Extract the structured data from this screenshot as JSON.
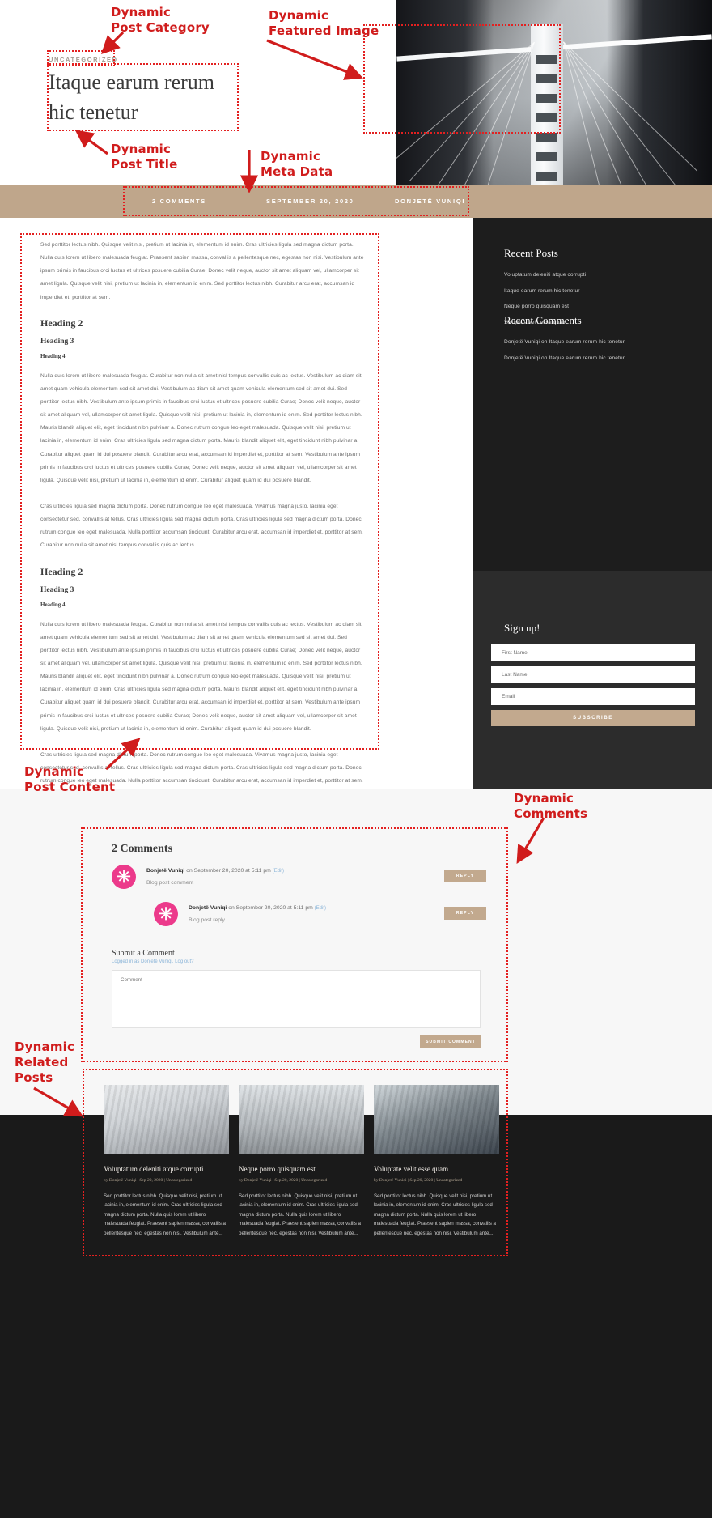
{
  "annotations": [
    {
      "id": "post-category",
      "label": "Dynamic\nPost Category"
    },
    {
      "id": "featured-image",
      "label": "Dynamic\nFeatured Image"
    },
    {
      "id": "post-title",
      "label": "Dynamic\nPost Title"
    },
    {
      "id": "meta-data",
      "label": "Dynamic\nMeta Data"
    },
    {
      "id": "post-content",
      "label": "Dynamic\nPost Content"
    },
    {
      "id": "comments",
      "label": "Dynamic\nComments"
    },
    {
      "id": "related-posts",
      "label": "Dynamic\nRelated\nPosts"
    }
  ],
  "colors": {
    "annotation_red": "#d01c1c",
    "dash_red": "#e32020",
    "meta_bar_tan": "#bfa68b",
    "button_tan": "#c2a98e",
    "sidebar_dark": "#1d1d1d",
    "signup_dark": "#2c2c2c",
    "related_dark": "#1a1a1a",
    "avatar_pink": "#ec3a8b",
    "link_blue": "#8ab4d8"
  },
  "hero": {
    "category": "UNCATEGORIZED",
    "title": "Itaque earum rerum hic tenetur",
    "featured_image_alt": "bridge-tower-photo"
  },
  "meta": {
    "comments": "2 COMMENTS",
    "date": "SEPTEMBER 20, 2020",
    "author": "DONJETË VUNIQI"
  },
  "article": {
    "p1": "Sed porttitor lectus nibh. Quisque velit nisi, pretium ut lacinia in, elementum id enim. Cras ultricies ligula sed magna dictum porta. Nulla quis lorem ut libero malesuada feugiat. Praesent sapien massa, convallis a pellentesque nec, egestas non nisi. Vestibulum ante ipsum primis in faucibus orci luctus et ultrices posuere cubilia Curae; Donec velit neque, auctor sit amet aliquam vel, ullamcorper sit amet ligula. Quisque velit nisi, pretium ut lacinia in, elementum id enim. Sed porttitor lectus nibh. Curabitur arcu erat, accumsan id imperdiet et, porttitor at sem.",
    "h2": "Heading 2",
    "h3": "Heading 3",
    "h4": "Heading 4",
    "p2": "Nulla quis lorem ut libero malesuada feugiat. Curabitur non nulla sit amet nisl tempus convallis quis ac lectus. Vestibulum ac diam sit amet quam vehicula elementum sed sit amet dui. Vestibulum ac diam sit amet quam vehicula elementum sed sit amet dui. Sed porttitor lectus nibh. Vestibulum ante ipsum primis in faucibus orci luctus et ultrices posuere cubilia Curae; Donec velit neque, auctor sit amet aliquam vel, ullamcorper sit amet ligula. Quisque velit nisi, pretium ut lacinia in, elementum id enim. Sed porttitor lectus nibh. Mauris blandit aliquet elit, eget tincidunt nibh pulvinar a. Donec rutrum congue leo eget malesuada. Quisque velit nisi, pretium ut lacinia in, elementum id enim. Cras ultricies ligula sed magna dictum porta. Mauris blandit aliquet elit, eget tincidunt nibh pulvinar a. Curabitur aliquet quam id dui posuere blandit. Curabitur arcu erat, accumsan id imperdiet et, porttitor at sem. Vestibulum ante ipsum primis in faucibus orci luctus et ultrices posuere cubilia Curae; Donec velit neque, auctor sit amet aliquam vel, ullamcorper sit amet ligula. Quisque velit nisi, pretium ut lacinia in, elementum id enim. Curabitur aliquet quam id dui posuere blandit.",
    "p3": "Cras ultricies ligula sed magna dictum porta. Donec rutrum congue leo eget malesuada. Vivamus magna justo, lacinia eget consectetur sed, convallis at tellus. Cras ultricies ligula sed magna dictum porta. Cras ultricies ligula sed magna dictum porta. Donec rutrum congue leo eget malesuada. Nulla porttitor accumsan tincidunt. Curabitur arcu erat, accumsan id imperdiet et, porttitor at sem. Curabitur non nulla sit amet nisl tempus convallis quis ac lectus."
  },
  "sidebar": {
    "recent_posts_title": "Recent Posts",
    "recent_posts": [
      "Voluptatum deleniti atque corrupti",
      "Itaque earum rerum hic tenetur",
      "Neque porro quisquam est",
      "Voluptate velit esse quam"
    ],
    "recent_comments_title": "Recent Comments",
    "recent_comments": [
      "Donjetë Vuniqi on Itaque earum rerum hic tenetur",
      "Donjetë Vuniqi on Itaque earum rerum hic tenetur"
    ]
  },
  "signup": {
    "title": "Sign up!",
    "first_name_placeholder": "First Name",
    "last_name_placeholder": "Last Name",
    "email_placeholder": "Email",
    "subscribe_label": "SUBSCRIBE"
  },
  "comments_section": {
    "heading": "2 Comments",
    "avatar_glyph": "✳",
    "items": [
      {
        "author": "Donjetë Vuniqi",
        "meta_rest": " on September 20, 2020 at 5:11 pm ",
        "edit": "(Edit)",
        "body": "Blog post comment",
        "reply_label": "REPLY"
      },
      {
        "author": "Donjetë Vuniqi",
        "meta_rest": " on September 20, 2020 at 5:11 pm ",
        "edit": "(Edit)",
        "body": "Blog post reply",
        "reply_label": "REPLY"
      }
    ],
    "submit_heading": "Submit a Comment",
    "logged_in": "Logged in as Donjetë Vuniqi. Log out?",
    "comment_placeholder": "Comment",
    "submit_label": "SUBMIT COMMENT"
  },
  "related_posts": {
    "items": [
      {
        "title": "Voluptatum deleniti atque corrupti",
        "meta": "by Donjetë Vuniqi | Sep 20, 2020 | Uncategorized",
        "excerpt": "Sed porttitor lectus nibh. Quisque velit nisi, pretium ut lacinia in, elementum id enim. Cras ultricies ligula sed magna dictum porta. Nulla quis lorem ut libero malesuada feugiat. Praesent sapien massa, convallis a pellentesque nec, egestas non nisi. Vestibulum ante...",
        "image": "city-building-grey"
      },
      {
        "title": "Neque porro quisquam est",
        "meta": "by Donjetë Vuniqi | Sep 20, 2020 | Uncategorized",
        "excerpt": "Sed porttitor lectus nibh. Quisque velit nisi, pretium ut lacinia in, elementum id enim. Cras ultricies ligula sed magna dictum porta. Nulla quis lorem ut libero malesuada feugiat. Praesent sapien massa, convallis a pellentesque nec, egestas non nisi. Vestibulum ante...",
        "image": "street-cars"
      },
      {
        "title": "Voluptate velit esse quam",
        "meta": "by Donjetë Vuniqi | Sep 20, 2020 | Uncategorized",
        "excerpt": "Sed porttitor lectus nibh. Quisque velit nisi, pretium ut lacinia in, elementum id enim. Cras ultricies ligula sed magna dictum porta. Nulla quis lorem ut libero malesuada feugiat. Praesent sapien massa, convallis a pellentesque nec, egestas non nisi. Vestibulum ante...",
        "image": "glass-tower"
      }
    ]
  }
}
